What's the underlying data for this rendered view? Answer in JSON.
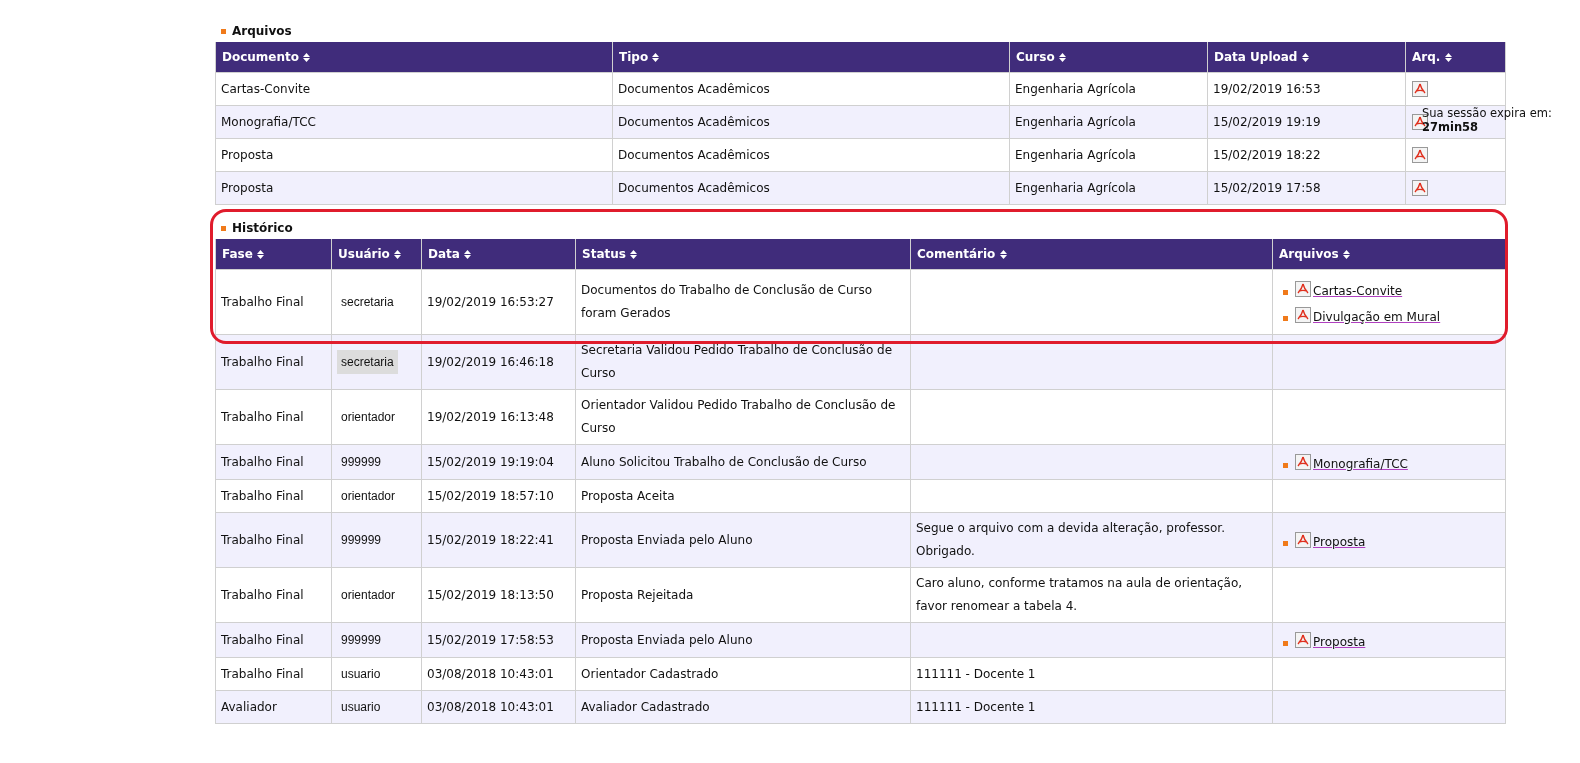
{
  "arquivos": {
    "title": "Arquivos",
    "columns": [
      "Documento",
      "Tipo",
      "Curso",
      "Data Upload",
      "Arq."
    ],
    "rows": [
      {
        "documento": "Cartas-Convite",
        "tipo": "Documentos Acadêmicos",
        "curso": "Engenharia Agrícola",
        "data_upload": "19/02/2019 16:53"
      },
      {
        "documento": "Monografia/TCC",
        "tipo": "Documentos Acadêmicos",
        "curso": "Engenharia Agrícola",
        "data_upload": "15/02/2019 19:19"
      },
      {
        "documento": "Proposta",
        "tipo": "Documentos Acadêmicos",
        "curso": "Engenharia Agrícola",
        "data_upload": "15/02/2019 18:22"
      },
      {
        "documento": "Proposta",
        "tipo": "Documentos Acadêmicos",
        "curso": "Engenharia Agrícola",
        "data_upload": "15/02/2019 17:58"
      }
    ]
  },
  "session": {
    "label": "Sua sessão expira em:",
    "time": "27min58"
  },
  "historico": {
    "title": "Histórico",
    "columns": [
      "Fase",
      "Usuário",
      "Data",
      "Status",
      "Comentário",
      "Arquivos"
    ],
    "rows": [
      {
        "fase": "Trabalho Final",
        "usuario": "secretaria",
        "data": "19/02/2019 16:53:27",
        "status": "Documentos do Trabalho de Conclusão de Curso foram Gerados",
        "comentario": "",
        "arquivos": [
          "Cartas-Convite",
          "Divulgação em Mural"
        ],
        "highlighted": true,
        "shaded": false
      },
      {
        "fase": "Trabalho Final",
        "usuario": "secretaria",
        "data": "19/02/2019 16:46:18",
        "status": "Secretaria Validou Pedido Trabalho de Conclusão de Curso",
        "comentario": "",
        "arquivos": [],
        "highlighted": false,
        "shaded": true
      },
      {
        "fase": "Trabalho Final",
        "usuario": "orientador",
        "data": "19/02/2019 16:13:48",
        "status": "Orientador Validou Pedido Trabalho de Conclusão de Curso",
        "comentario": "",
        "arquivos": [],
        "highlighted": false,
        "shaded": false
      },
      {
        "fase": "Trabalho Final",
        "usuario": "999999",
        "data": "15/02/2019 19:19:04",
        "status": "Aluno Solicitou Trabalho de Conclusão de Curso",
        "comentario": "",
        "arquivos": [
          "Monografia/TCC"
        ],
        "highlighted": false,
        "shaded": false
      },
      {
        "fase": "Trabalho Final",
        "usuario": "orientador",
        "data": "15/02/2019 18:57:10",
        "status": "Proposta Aceita",
        "comentario": "",
        "arquivos": [],
        "highlighted": false,
        "shaded": false
      },
      {
        "fase": "Trabalho Final",
        "usuario": "999999",
        "data": "15/02/2019 18:22:41",
        "status": "Proposta Enviada pelo Aluno",
        "comentario": "Segue o arquivo com a devida alteração, professor. Obrigado.",
        "arquivos": [
          "Proposta"
        ],
        "highlighted": false,
        "shaded": false
      },
      {
        "fase": "Trabalho Final",
        "usuario": "orientador",
        "data": "15/02/2019 18:13:50",
        "status": "Proposta Rejeitada",
        "comentario": "Caro aluno, conforme tratamos na aula de orientação, favor renomear a tabela 4.",
        "arquivos": [],
        "highlighted": false,
        "shaded": false
      },
      {
        "fase": "Trabalho Final",
        "usuario": "999999",
        "data": "15/02/2019 17:58:53",
        "status": "Proposta Enviada pelo Aluno",
        "comentario": "",
        "arquivos": [
          "Proposta"
        ],
        "highlighted": false,
        "shaded": false
      },
      {
        "fase": "Trabalho Final",
        "usuario": "usuario",
        "data": "03/08/2018 10:43:01",
        "status": "Orientador Cadastrado",
        "comentario": "111111 - Docente 1",
        "arquivos": [],
        "highlighted": false,
        "shaded": false
      },
      {
        "fase": "Avaliador",
        "usuario": "usuario",
        "data": "03/08/2018 10:43:01",
        "status": "Avaliador Cadastrado",
        "comentario": "111111 - Docente 1",
        "arquivos": [],
        "highlighted": false,
        "shaded": false
      }
    ]
  }
}
